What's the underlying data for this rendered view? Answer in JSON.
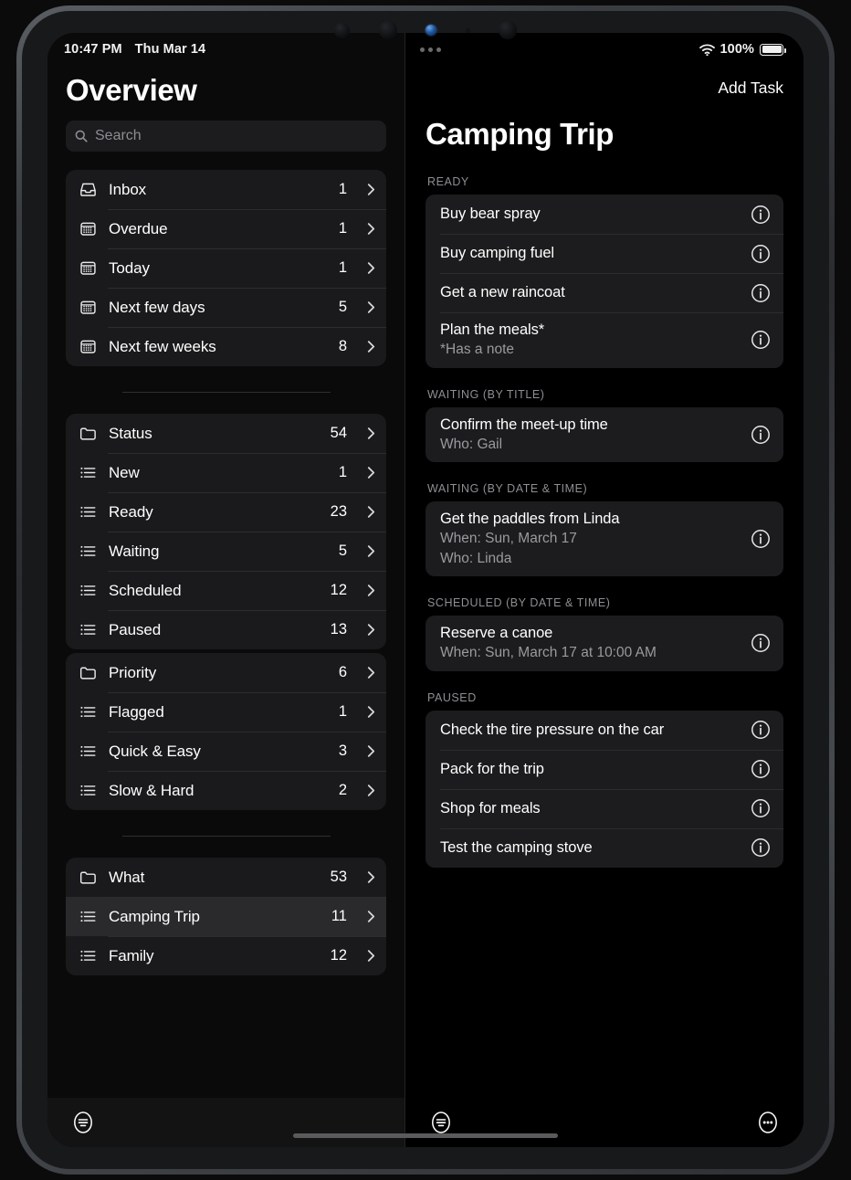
{
  "status_bar": {
    "time": "10:47 PM",
    "date": "Thu Mar 14",
    "battery_percent": "100%",
    "wifi_icon": "wifi-icon",
    "battery_icon": "battery-icon",
    "multitask_icon": "multitask-dots-icon"
  },
  "sidebar": {
    "title": "Overview",
    "search": {
      "placeholder": "Search",
      "icon": "search-icon"
    },
    "groups": [
      {
        "id": "time-group",
        "rows": [
          {
            "label": "Inbox",
            "count": "1",
            "icon": "inbox-icon",
            "selected": false
          },
          {
            "label": "Overdue",
            "count": "1",
            "icon": "calendar-icon",
            "selected": false
          },
          {
            "label": "Today",
            "count": "1",
            "icon": "calendar-icon",
            "selected": false
          },
          {
            "label": "Next few days",
            "count": "5",
            "icon": "calendar-icon",
            "selected": false
          },
          {
            "label": "Next few weeks",
            "count": "8",
            "icon": "calendar-icon",
            "selected": false
          }
        ],
        "divider_after": true
      },
      {
        "id": "status-group",
        "rows": [
          {
            "label": "Status",
            "count": "54",
            "icon": "folder-icon",
            "selected": false
          },
          {
            "label": "New",
            "count": "1",
            "icon": "list-icon",
            "selected": false
          },
          {
            "label": "Ready",
            "count": "23",
            "icon": "list-icon",
            "selected": false
          },
          {
            "label": "Waiting",
            "count": "5",
            "icon": "list-icon",
            "selected": false
          },
          {
            "label": "Scheduled",
            "count": "12",
            "icon": "list-icon",
            "selected": false
          },
          {
            "label": "Paused",
            "count": "13",
            "icon": "list-icon",
            "selected": false
          }
        ],
        "divider_after": false
      },
      {
        "id": "priority-group",
        "rows": [
          {
            "label": "Priority",
            "count": "6",
            "icon": "folder-icon",
            "selected": false
          },
          {
            "label": "Flagged",
            "count": "1",
            "icon": "list-icon",
            "selected": false
          },
          {
            "label": "Quick & Easy",
            "count": "3",
            "icon": "list-icon",
            "selected": false
          },
          {
            "label": "Slow & Hard",
            "count": "2",
            "icon": "list-icon",
            "selected": false
          }
        ],
        "divider_after": true
      },
      {
        "id": "what-group",
        "rows": [
          {
            "label": "What",
            "count": "53",
            "icon": "folder-icon",
            "selected": false
          },
          {
            "label": "Camping Trip",
            "count": "11",
            "icon": "list-icon",
            "selected": true
          },
          {
            "label": "Family",
            "count": "12",
            "icon": "list-icon",
            "selected": false
          }
        ],
        "divider_after": false
      }
    ],
    "toolbar": {
      "filter_icon": "filter-list-icon"
    }
  },
  "detail": {
    "title": "Camping Trip",
    "add_task_label": "Add Task",
    "sections": [
      {
        "header": "READY",
        "tasks": [
          {
            "title": "Buy bear spray",
            "sub": "",
            "info_icon": "info-icon"
          },
          {
            "title": "Buy camping fuel",
            "sub": "",
            "info_icon": "info-icon"
          },
          {
            "title": "Get a new raincoat",
            "sub": "",
            "info_icon": "info-icon"
          },
          {
            "title": "Plan the meals*",
            "sub": "*Has a note",
            "info_icon": "info-icon"
          }
        ]
      },
      {
        "header": "WAITING (BY TITLE)",
        "tasks": [
          {
            "title": "Confirm the meet-up time",
            "sub": "Who: Gail",
            "info_icon": "info-icon"
          }
        ]
      },
      {
        "header": "WAITING (BY DATE & TIME)",
        "tasks": [
          {
            "title": "Get the paddles from Linda",
            "sub": "When: Sun, March 17\nWho: Linda",
            "info_icon": "info-icon"
          }
        ]
      },
      {
        "header": "SCHEDULED (BY DATE & TIME)",
        "tasks": [
          {
            "title": "Reserve a canoe",
            "sub": "When: Sun, March 17 at 10:00 AM",
            "info_icon": "info-icon"
          }
        ]
      },
      {
        "header": "PAUSED",
        "tasks": [
          {
            "title": "Check the tire pressure on the car",
            "sub": "",
            "info_icon": "info-icon"
          },
          {
            "title": "Pack for the trip",
            "sub": "",
            "info_icon": "info-icon"
          },
          {
            "title": "Shop for meals",
            "sub": "",
            "info_icon": "info-icon"
          },
          {
            "title": "Test the camping stove",
            "sub": "",
            "info_icon": "info-icon"
          }
        ]
      }
    ],
    "toolbar": {
      "filter_icon": "filter-list-icon",
      "more_icon": "more-ellipsis-icon"
    }
  },
  "colors": {
    "background": "#000000",
    "card": "#1c1c1e",
    "selected_row": "#2a2a2c",
    "secondary_text": "#8e8e93",
    "primary_text": "#ffffff"
  }
}
